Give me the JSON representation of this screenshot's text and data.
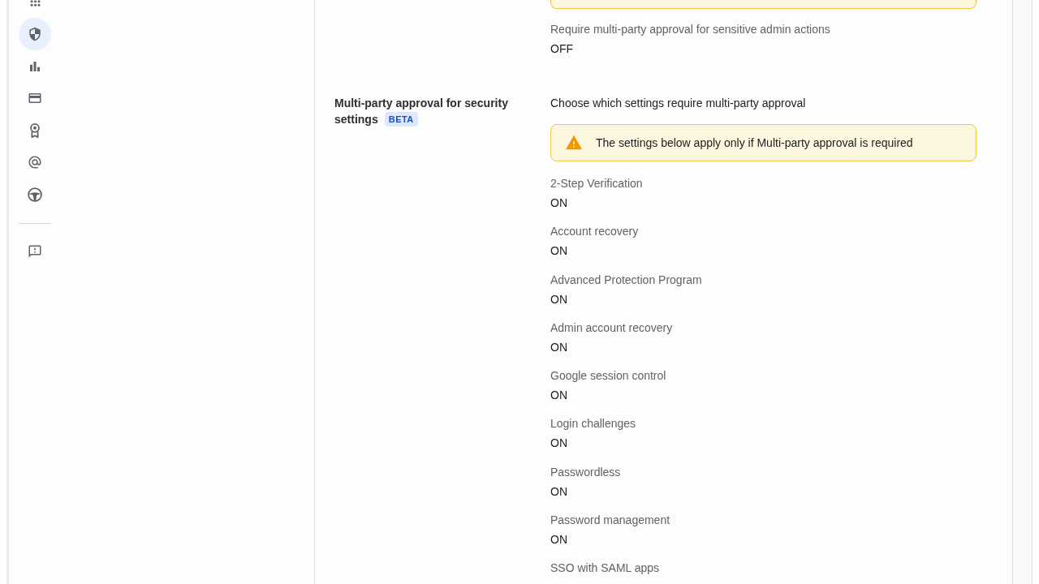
{
  "nav_rail": {
    "items": [
      {
        "selected": false
      },
      {
        "selected": true
      },
      {
        "selected": false
      },
      {
        "selected": false
      },
      {
        "selected": false
      },
      {
        "selected": false
      },
      {
        "selected": false
      }
    ],
    "footer_items": [
      {
        "selected": false
      }
    ]
  },
  "admin_actions": {
    "label": "Require multi-party approval for sensitive admin actions",
    "value": "OFF"
  },
  "sections": [
    {
      "title": "Multi-party approval for security settings",
      "badge": "BETA",
      "description": "Choose which settings require multi-party approval",
      "notice": "The settings below apply only if Multi-party approval is required",
      "settings": [
        {
          "label": "2-Step Verification",
          "value": "ON"
        },
        {
          "label": "Account recovery",
          "value": "ON"
        },
        {
          "label": "Advanced Protection Program",
          "value": "ON"
        },
        {
          "label": "Admin account recovery",
          "value": "ON"
        },
        {
          "label": "Google session control",
          "value": "ON"
        },
        {
          "label": "Login challenges",
          "value": "ON"
        },
        {
          "label": "Passwordless",
          "value": "ON"
        },
        {
          "label": "Password management",
          "value": "ON"
        },
        {
          "label": "SSO with SAML apps"
        }
      ]
    }
  ]
}
